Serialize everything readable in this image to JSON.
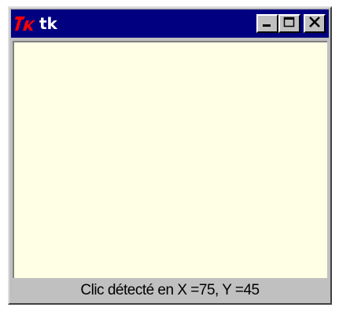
{
  "window": {
    "title": "tk",
    "icon": "tk-logo-icon"
  },
  "title_buttons": {
    "minimize_icon": "minimize-icon",
    "maximize_icon": "maximize-icon",
    "close_icon": "close-icon"
  },
  "canvas": {
    "background_color": "#ffffe6"
  },
  "status": {
    "text": "Clic détecté en X =75, Y =45"
  },
  "colors": {
    "titlebar": "#000080",
    "logo": "#ff0000"
  }
}
